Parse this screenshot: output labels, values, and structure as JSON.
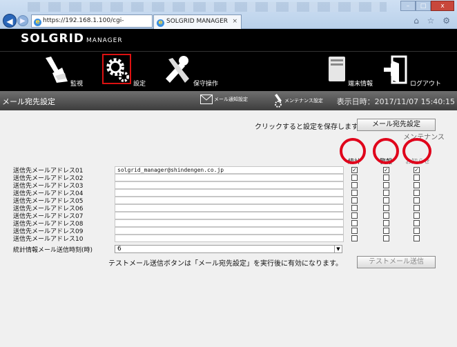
{
  "browser": {
    "address": "https://192.168.1.100/cgi-",
    "tab_title": "SOLGRID MANAGER",
    "tab_close": "×",
    "back": "◀",
    "forward": "▶",
    "right_icons": "⌂ ☆ ⚙",
    "window_buttons": [
      "–",
      "□",
      "x"
    ]
  },
  "app": {
    "logo_main": "SOLGRID",
    "logo_sub": "MANAGER",
    "nav": [
      {
        "label": "監視"
      },
      {
        "label": "設定"
      },
      {
        "label": "保守操作"
      },
      {
        "label": "端末情報"
      },
      {
        "label": "ログアウト"
      }
    ],
    "title": "メール宛先設定",
    "mail_settings_label": "メール通知設定",
    "maintenance_settings_label": "メンテナンス設定",
    "datetime": "表示日時：2017/11/07 15:40:15"
  },
  "form": {
    "hint": "クリックすると設定を保存します。",
    "save_button": "メール宛先設定",
    "columns": {
      "stats": "統計",
      "alarm": "警報",
      "maintenance_line1": "メンテナンス",
      "maintenance_line2": "お知らせ"
    },
    "rows": [
      {
        "label": "送信先メールアドレス01",
        "value": "solgrid_manager@shindengen.co.jp",
        "stats": true,
        "alarm": true,
        "maint": true
      },
      {
        "label": "送信先メールアドレス02",
        "value": "",
        "stats": false,
        "alarm": false,
        "maint": false
      },
      {
        "label": "送信先メールアドレス03",
        "value": "",
        "stats": false,
        "alarm": false,
        "maint": false
      },
      {
        "label": "送信先メールアドレス04",
        "value": "",
        "stats": false,
        "alarm": false,
        "maint": false
      },
      {
        "label": "送信先メールアドレス05",
        "value": "",
        "stats": false,
        "alarm": false,
        "maint": false
      },
      {
        "label": "送信先メールアドレス06",
        "value": "",
        "stats": false,
        "alarm": false,
        "maint": false
      },
      {
        "label": "送信先メールアドレス07",
        "value": "",
        "stats": false,
        "alarm": false,
        "maint": false
      },
      {
        "label": "送信先メールアドレス08",
        "value": "",
        "stats": false,
        "alarm": false,
        "maint": false
      },
      {
        "label": "送信先メールアドレス09",
        "value": "",
        "stats": false,
        "alarm": false,
        "maint": false
      },
      {
        "label": "送信先メールアドレス10",
        "value": "",
        "stats": false,
        "alarm": false,
        "maint": false
      }
    ],
    "schedule_label": "統計情報メール送信時刻(時)",
    "schedule_value": "6",
    "note": "テストメール送信ボタンは「メール宛先設定」を実行後に有効になります。",
    "test_button": "テストメール送信"
  },
  "colors": {
    "header_bg": "#000000",
    "highlight": "#e0001a",
    "title_bar": "#4a4a4a"
  }
}
